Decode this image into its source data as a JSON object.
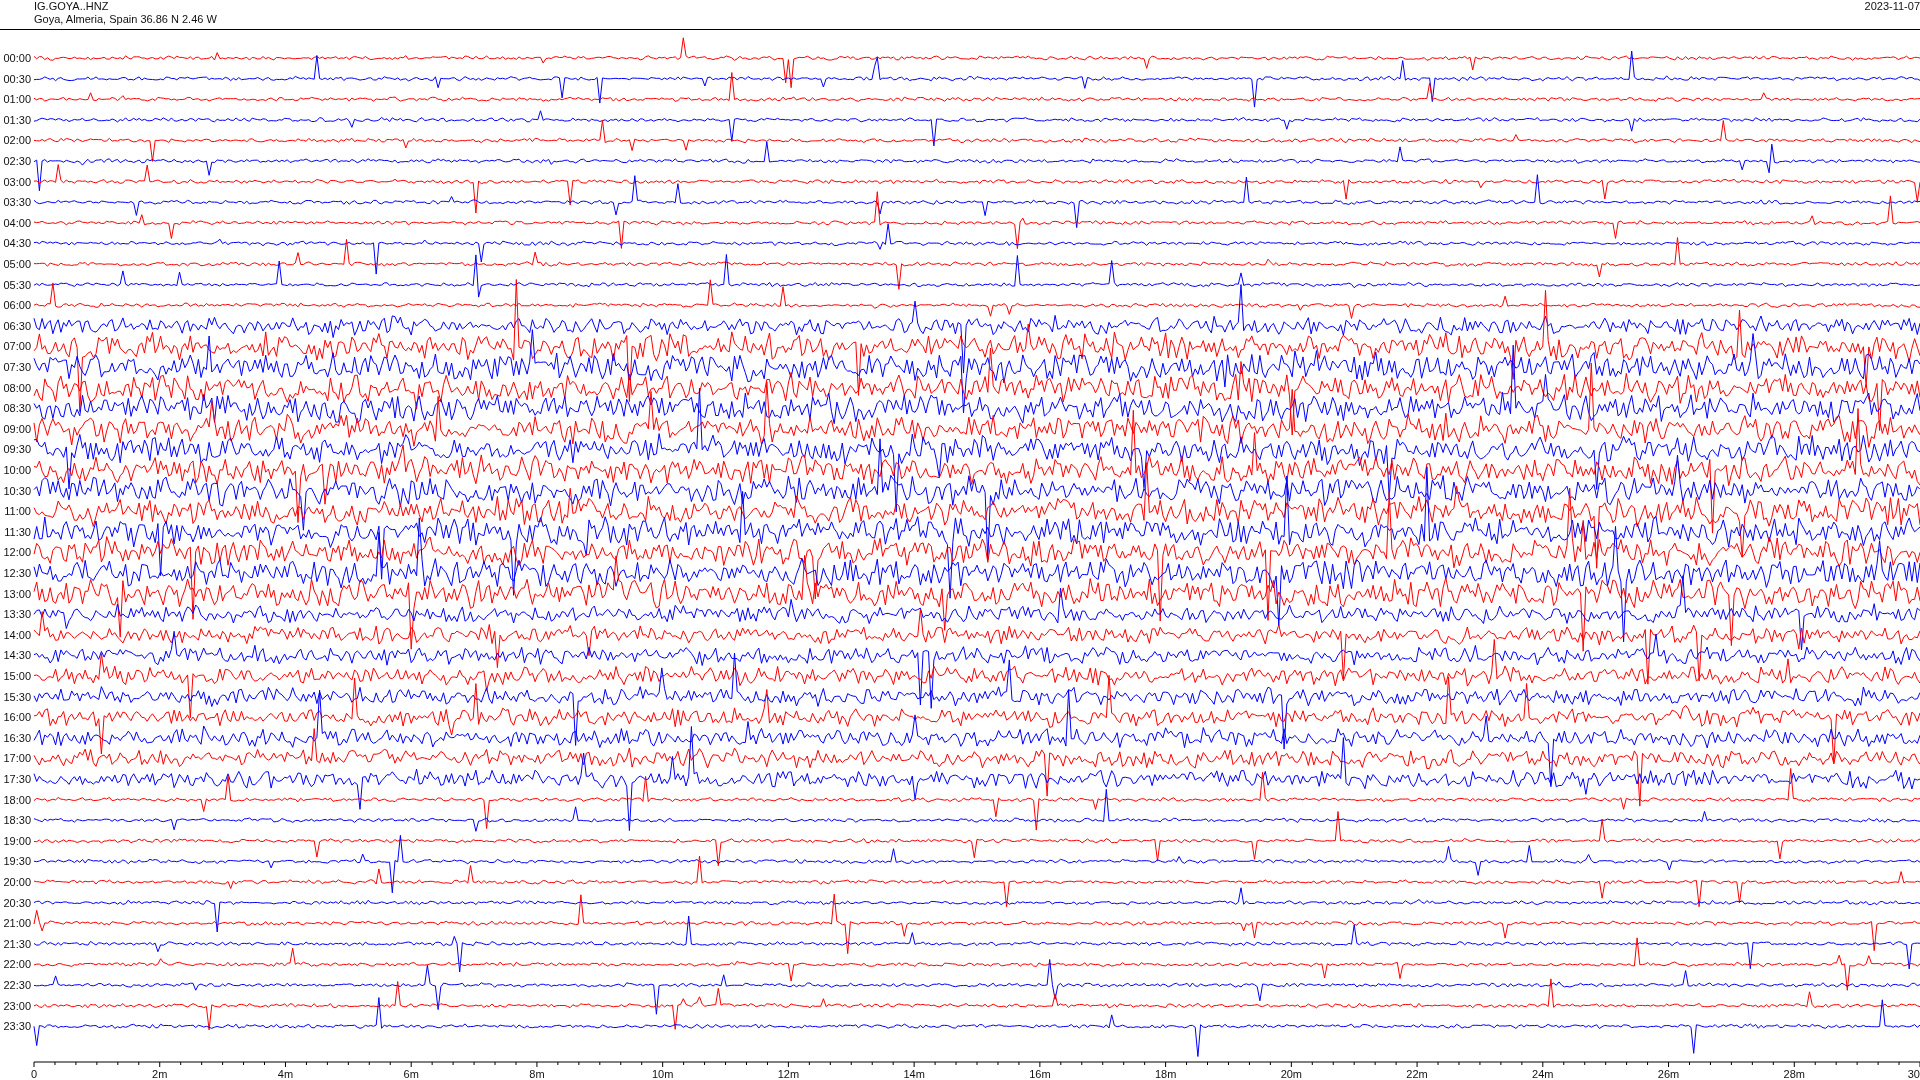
{
  "header": {
    "station": "IG.GOYA..HNZ",
    "location": "Goya, Almeria, Spain  36.86 N 2.46 W",
    "date": "2023-11-07"
  },
  "rows": [
    {
      "label": "00:00",
      "color": "#ff0000"
    },
    {
      "label": "00:30",
      "color": "#0000ff"
    },
    {
      "label": "01:00",
      "color": "#ff0000"
    },
    {
      "label": "01:30",
      "color": "#0000ff"
    },
    {
      "label": "02:00",
      "color": "#ff0000"
    },
    {
      "label": "02:30",
      "color": "#0000ff"
    },
    {
      "label": "03:00",
      "color": "#ff0000"
    },
    {
      "label": "03:30",
      "color": "#0000ff"
    },
    {
      "label": "04:00",
      "color": "#ff0000"
    },
    {
      "label": "04:30",
      "color": "#0000ff"
    },
    {
      "label": "05:00",
      "color": "#ff0000"
    },
    {
      "label": "05:30",
      "color": "#0000ff"
    },
    {
      "label": "06:00",
      "color": "#ff0000"
    },
    {
      "label": "06:30",
      "color": "#0000ff"
    },
    {
      "label": "07:00",
      "color": "#ff0000"
    },
    {
      "label": "07:30",
      "color": "#0000ff"
    },
    {
      "label": "08:00",
      "color": "#ff0000"
    },
    {
      "label": "08:30",
      "color": "#0000ff"
    },
    {
      "label": "09:00",
      "color": "#ff0000"
    },
    {
      "label": "09:30",
      "color": "#0000ff"
    },
    {
      "label": "10:00",
      "color": "#ff0000"
    },
    {
      "label": "10:30",
      "color": "#0000ff"
    },
    {
      "label": "11:00",
      "color": "#ff0000"
    },
    {
      "label": "11:30",
      "color": "#0000ff"
    },
    {
      "label": "12:00",
      "color": "#ff0000"
    },
    {
      "label": "12:30",
      "color": "#0000ff"
    },
    {
      "label": "13:00",
      "color": "#ff0000"
    },
    {
      "label": "13:30",
      "color": "#0000ff"
    },
    {
      "label": "14:00",
      "color": "#ff0000"
    },
    {
      "label": "14:30",
      "color": "#0000ff"
    },
    {
      "label": "15:00",
      "color": "#ff0000"
    },
    {
      "label": "15:30",
      "color": "#0000ff"
    },
    {
      "label": "16:00",
      "color": "#ff0000"
    },
    {
      "label": "16:30",
      "color": "#0000ff"
    },
    {
      "label": "17:00",
      "color": "#ff0000"
    },
    {
      "label": "17:30",
      "color": "#0000ff"
    },
    {
      "label": "18:00",
      "color": "#ff0000"
    },
    {
      "label": "18:30",
      "color": "#0000ff"
    },
    {
      "label": "19:00",
      "color": "#ff0000"
    },
    {
      "label": "19:30",
      "color": "#0000ff"
    },
    {
      "label": "20:00",
      "color": "#ff0000"
    },
    {
      "label": "20:30",
      "color": "#0000ff"
    },
    {
      "label": "21:00",
      "color": "#ff0000"
    },
    {
      "label": "21:30",
      "color": "#0000ff"
    },
    {
      "label": "22:00",
      "color": "#ff0000"
    },
    {
      "label": "22:30",
      "color": "#0000ff"
    },
    {
      "label": "23:00",
      "color": "#ff0000"
    },
    {
      "label": "23:30",
      "color": "#0000ff"
    }
  ],
  "x_axis": {
    "labels": [
      "0",
      "2m",
      "4m",
      "6m",
      "8m",
      "10m",
      "12m",
      "14m",
      "16m",
      "18m",
      "20m",
      "22m",
      "24m",
      "26m",
      "28m",
      "30"
    ]
  }
}
